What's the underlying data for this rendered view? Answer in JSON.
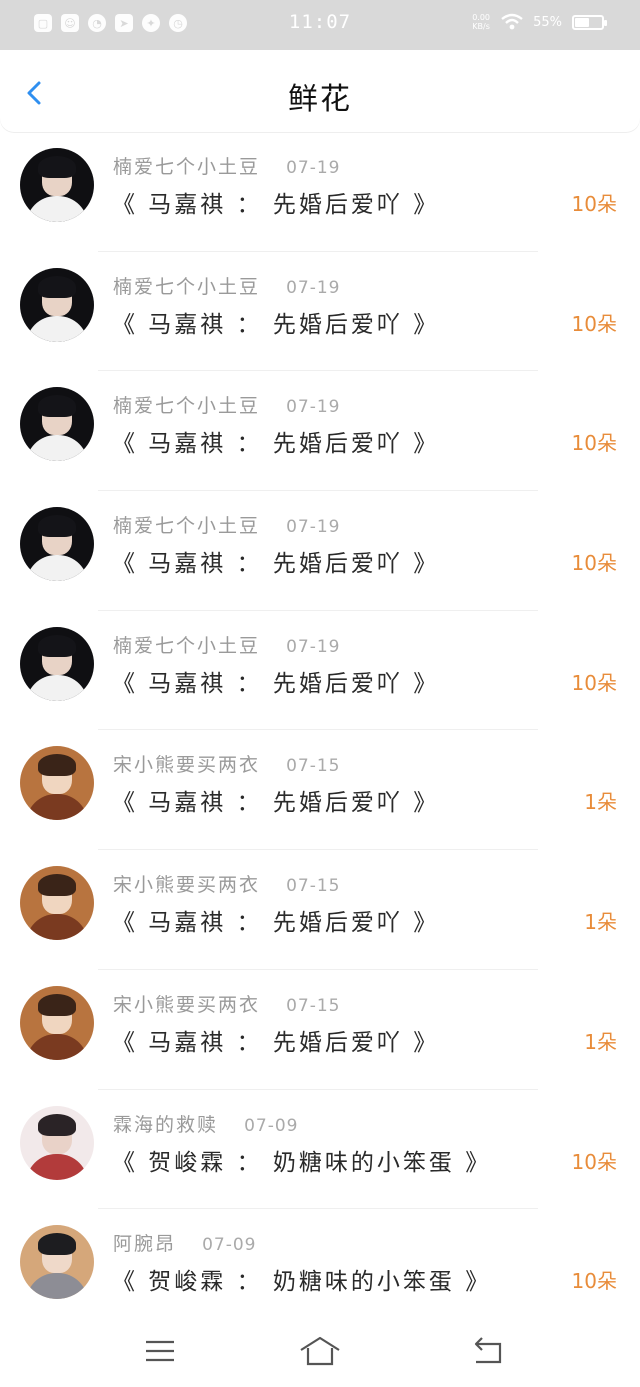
{
  "status_bar": {
    "time": "11:07",
    "battery": "55%",
    "battery_level": 0.55,
    "net_speed_value": "0.00",
    "net_speed_unit": "KB/s",
    "left_icons": [
      "sim-icon",
      "emoji-icon",
      "chat-icon",
      "telegram-icon",
      "fox-icon",
      "compass-icon"
    ],
    "right_icons": [
      "wifi-icon",
      "battery-icon"
    ]
  },
  "header": {
    "title": "鲜花",
    "back_icon": "chevron-left-icon",
    "accent": "#2f8ff0"
  },
  "colors": {
    "amount": "#e88c3a"
  },
  "rows": [
    {
      "name": "楠爱七个小土豆",
      "date": "07-19",
      "book": "《 马嘉祺 ： 先婚后爱吖 》",
      "amount": "10朵",
      "avatar": "a"
    },
    {
      "name": "楠爱七个小土豆",
      "date": "07-19",
      "book": "《 马嘉祺 ： 先婚后爱吖 》",
      "amount": "10朵",
      "avatar": "a"
    },
    {
      "name": "楠爱七个小土豆",
      "date": "07-19",
      "book": "《 马嘉祺 ： 先婚后爱吖 》",
      "amount": "10朵",
      "avatar": "a"
    },
    {
      "name": "楠爱七个小土豆",
      "date": "07-19",
      "book": "《 马嘉祺 ： 先婚后爱吖 》",
      "amount": "10朵",
      "avatar": "a"
    },
    {
      "name": "楠爱七个小土豆",
      "date": "07-19",
      "book": "《 马嘉祺 ： 先婚后爱吖 》",
      "amount": "10朵",
      "avatar": "a"
    },
    {
      "name": "宋小熊要买两衣",
      "date": "07-15",
      "book": "《 马嘉祺 ： 先婚后爱吖 》",
      "amount": "1朵",
      "avatar": "b"
    },
    {
      "name": "宋小熊要买两衣",
      "date": "07-15",
      "book": "《 马嘉祺 ： 先婚后爱吖 》",
      "amount": "1朵",
      "avatar": "b"
    },
    {
      "name": "宋小熊要买两衣",
      "date": "07-15",
      "book": "《 马嘉祺 ： 先婚后爱吖 》",
      "amount": "1朵",
      "avatar": "b"
    },
    {
      "name": "霖海的救赎",
      "date": "07-09",
      "book": "《 贺峻霖 ： 奶糖味的小笨蛋 》",
      "amount": "10朵",
      "avatar": "c"
    },
    {
      "name": "阿腕昂",
      "date": "07-09",
      "book": "《 贺峻霖 ： 奶糖味的小笨蛋 》",
      "amount": "10朵",
      "avatar": "d"
    }
  ],
  "nav": {
    "menu_icon": "menu-icon",
    "home_icon": "home-icon",
    "back_icon": "back-arrow-icon"
  }
}
